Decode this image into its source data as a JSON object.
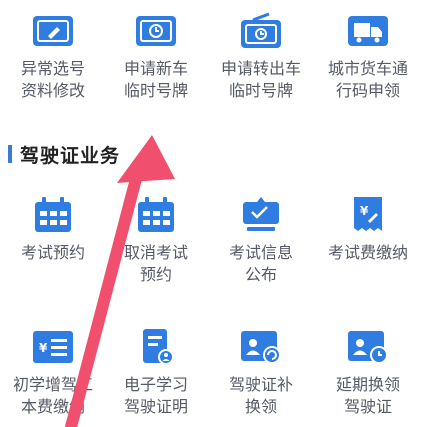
{
  "top_row": [
    {
      "line1": "异常选号",
      "line2": "资料修改",
      "icon": "card-edit-icon"
    },
    {
      "line1": "申请新车",
      "line2": "临时号牌",
      "icon": "clock-plate-icon"
    },
    {
      "line1": "申请转出车",
      "line2": "临时号牌",
      "icon": "clock-plate-transfer-icon"
    },
    {
      "line1": "城市货车通",
      "line2": "行码申领",
      "icon": "truck-icon"
    }
  ],
  "section": {
    "title": "驾驶证业务"
  },
  "row2": [
    {
      "line1": "考试预约",
      "line2": "",
      "icon": "calendar-icon"
    },
    {
      "line1": "取消考试",
      "line2": "预约",
      "icon": "calendar-cancel-icon"
    },
    {
      "line1": "考试信息",
      "line2": "公布",
      "icon": "info-board-icon"
    },
    {
      "line1": "考试费缴纳",
      "line2": "",
      "icon": "yuan-receipt-icon"
    }
  ],
  "row3": [
    {
      "line1": "初学增驾工",
      "line2": "本费缴纳",
      "icon": "yuan-card-icon"
    },
    {
      "line1": "电子学习",
      "line2": "驾驶证明",
      "icon": "document-user-icon"
    },
    {
      "line1": "驾驶证补",
      "line2": "换领",
      "icon": "license-refresh-icon"
    },
    {
      "line1": "延期换领",
      "line2": "驾驶证",
      "icon": "license-clock-icon"
    }
  ],
  "colors": {
    "icon_blue": "#2f7de1",
    "accent": "#3a7bd5",
    "arrow": "#f0506e"
  }
}
